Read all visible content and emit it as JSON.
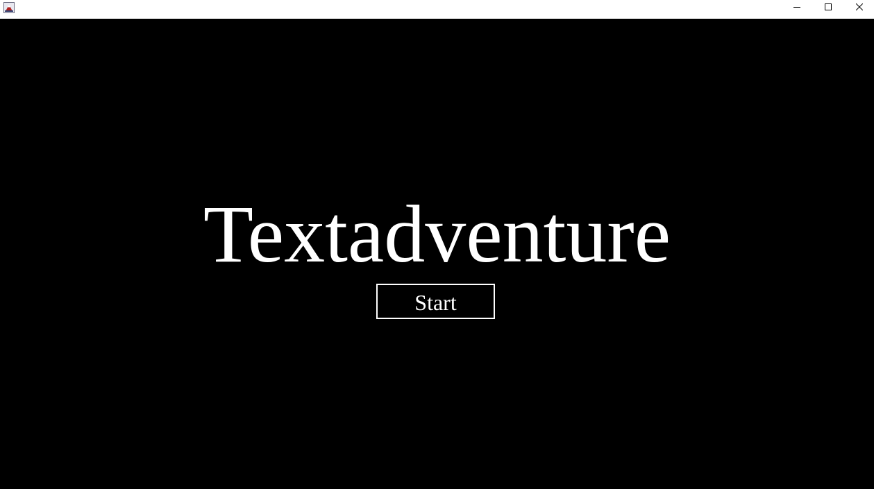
{
  "window": {
    "icon": "java-app-icon",
    "controls": {
      "minimize": "minimize-icon",
      "maximize": "maximize-icon",
      "close": "close-icon"
    }
  },
  "main": {
    "title": "Textadventure",
    "start_label": "Start"
  },
  "colors": {
    "background": "#000000",
    "foreground": "#ffffff",
    "titlebar": "#ffffff"
  }
}
